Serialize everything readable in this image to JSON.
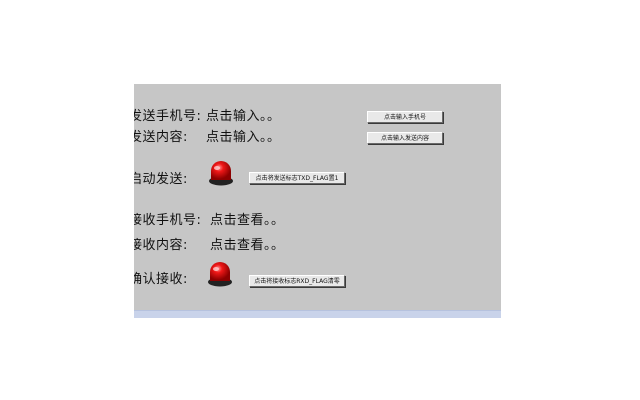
{
  "form": {
    "send_phone": {
      "label": "发送手机号:",
      "value": "点击输入。。",
      "button": "点击输入手机号"
    },
    "send_content": {
      "label": "发送内容:",
      "value": "点击输入。。",
      "button": "点击输入发送内容"
    },
    "start_send": {
      "label": "启动发送:",
      "button": "点击将发送标志TXD_FLAG置1",
      "indicator": {
        "icon": "red-led-icon",
        "state": "on"
      }
    },
    "recv_phone": {
      "label": "接收手机号:",
      "value": "点击查看。。"
    },
    "recv_content": {
      "label": "接收内容:",
      "value": "点击查看。。"
    },
    "confirm_recv": {
      "label": "确认接收:",
      "button": "点击将接收标志RXD_FLAG清零",
      "indicator": {
        "icon": "red-led-icon",
        "state": "on"
      }
    }
  },
  "colors": {
    "panel_background": "#c6c6c6",
    "led_red": "#e01010",
    "button_face": "#e9e9e9"
  }
}
